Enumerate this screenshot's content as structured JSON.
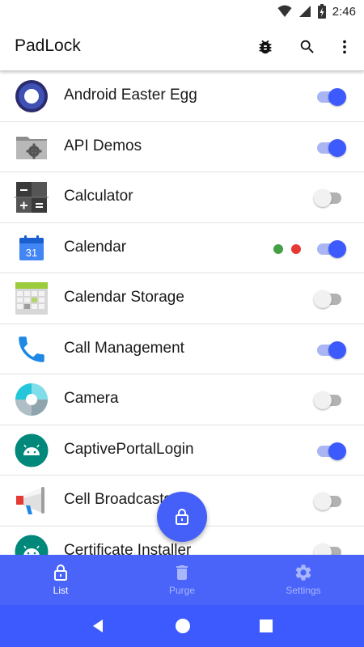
{
  "status_bar": {
    "time": "2:46"
  },
  "app_bar": {
    "title": "PadLock"
  },
  "apps": [
    {
      "label": "Android Easter Egg",
      "icon": "android-easter-egg-icon",
      "enabled": true
    },
    {
      "label": "API Demos",
      "icon": "api-demos-folder-icon",
      "enabled": true
    },
    {
      "label": "Calculator",
      "icon": "calculator-icon",
      "enabled": false
    },
    {
      "label": "Calendar",
      "icon": "calendar-icon",
      "enabled": true,
      "date": "31",
      "status_dots": [
        "#43a047",
        "#e53935"
      ]
    },
    {
      "label": "Calendar Storage",
      "icon": "calendar-storage-icon",
      "enabled": false
    },
    {
      "label": "Call Management",
      "icon": "phone-icon",
      "enabled": true
    },
    {
      "label": "Camera",
      "icon": "camera-icon",
      "enabled": false
    },
    {
      "label": "CaptivePortalLogin",
      "icon": "android-robot-icon",
      "enabled": true
    },
    {
      "label": "Cell Broadcasts",
      "icon": "megaphone-icon",
      "enabled": false
    },
    {
      "label": "Certificate Installer",
      "icon": "android-robot-icon",
      "enabled": false
    }
  ],
  "bottom_nav": {
    "items": [
      {
        "label": "List",
        "icon": "lock-icon",
        "active": true
      },
      {
        "label": "Purge",
        "icon": "trash-icon",
        "active": false
      },
      {
        "label": "Settings",
        "icon": "gear-icon",
        "active": false
      }
    ]
  },
  "colors": {
    "accent": "#3d5afe",
    "nav_bar": "#4a64f9",
    "toggle_on_track": "#a9b6f3",
    "toggle_off_track": "#b2b2b2"
  }
}
